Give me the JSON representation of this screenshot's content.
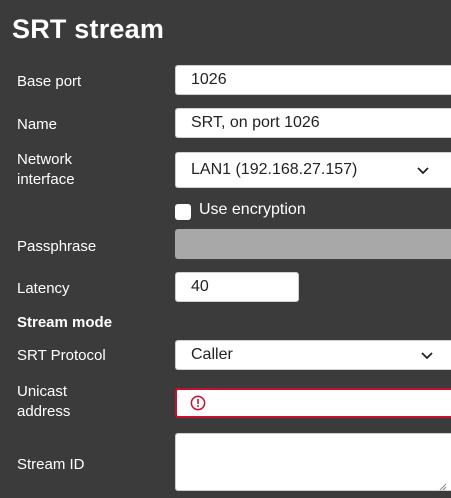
{
  "title": "SRT stream",
  "fields": {
    "base_port": {
      "label": "Base port",
      "value": "1026"
    },
    "name": {
      "label": "Name",
      "value": "SRT, on port 1026"
    },
    "network_interface": {
      "label_line1": "Network",
      "label_line2": "interface",
      "value": "LAN1 (192.168.27.157)"
    },
    "use_encryption": {
      "label": "Use encryption",
      "checked": false
    },
    "passphrase": {
      "label": "Passphrase",
      "value": ""
    },
    "latency": {
      "label": "Latency",
      "value": "40"
    },
    "stream_mode": {
      "label": "Stream mode"
    },
    "srt_protocol": {
      "label": "SRT Protocol",
      "value": "Caller"
    },
    "unicast_address": {
      "label_line1": "Unicast",
      "label_line2": "address",
      "value": "",
      "state": "error"
    },
    "stream_id": {
      "label": "Stream ID",
      "value": ""
    }
  },
  "icons": {
    "dropdown": "chevron-down-icon",
    "error": "exclamation-circle-icon",
    "resize": "resize-handle-icon"
  },
  "colors": {
    "panel_bg": "#3b3b3b",
    "error": "#c8102e",
    "disabled": "#a8a8a8"
  }
}
